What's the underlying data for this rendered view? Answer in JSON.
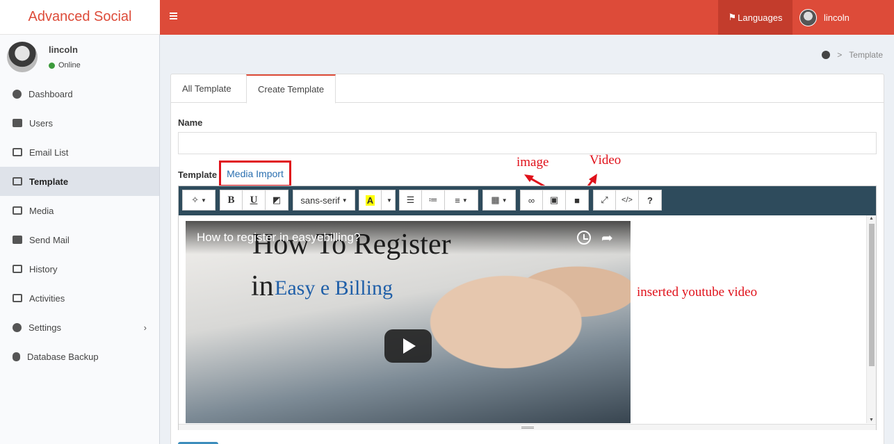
{
  "app": {
    "title": "Advanced Social"
  },
  "topbar": {
    "languages_label": "Languages",
    "user_name": "lincoln"
  },
  "user_panel": {
    "name": "lincoln",
    "status": "Online"
  },
  "sidebar": {
    "items": [
      {
        "label": "Dashboard",
        "icon": "dashboard-icon"
      },
      {
        "label": "Users",
        "icon": "users-icon"
      },
      {
        "label": "Email List",
        "icon": "list-icon"
      },
      {
        "label": "Template",
        "icon": "template-icon",
        "active": true
      },
      {
        "label": "Media",
        "icon": "image-icon"
      },
      {
        "label": "Send Mail",
        "icon": "envelope-icon"
      },
      {
        "label": "History",
        "icon": "history-icon"
      },
      {
        "label": "Activities",
        "icon": "activities-icon"
      },
      {
        "label": "Settings",
        "icon": "gears-icon",
        "has_submenu": true
      },
      {
        "label": "Database Backup",
        "icon": "database-icon"
      }
    ]
  },
  "breadcrumb": {
    "current": "Template"
  },
  "tabs": [
    {
      "label": "All Template"
    },
    {
      "label": "Create Template",
      "active": true
    }
  ],
  "form": {
    "name_label": "Name",
    "name_value": "",
    "template_label": "Template",
    "media_import_label": "Media Import"
  },
  "toolbar": {
    "font_name": "sans-serif",
    "bold_label": "B",
    "underline_label": "U",
    "color_label": "A",
    "code_label": "</>",
    "help_label": "?"
  },
  "annotations": {
    "image_label": "image",
    "video_label": "Video",
    "inserted_note": "inserted youtube video"
  },
  "video": {
    "title": "How to register in easyebilling?",
    "headline": "How To Register",
    "in_text": "in",
    "logo_text": "Easy e Billing"
  },
  "colors": {
    "accent": "#dd4b39",
    "annotation_red": "#e0121b",
    "toolbar_bg": "#2e4b5c",
    "link_blue": "#2a6fb0"
  }
}
